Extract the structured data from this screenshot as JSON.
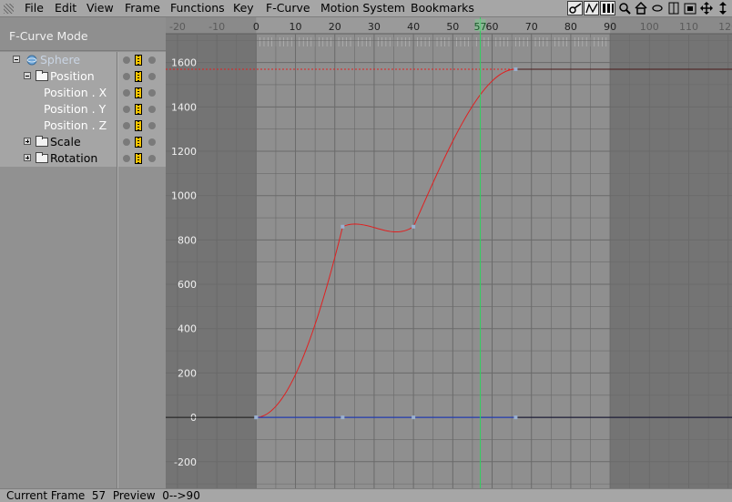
{
  "menu": {
    "items": [
      "File",
      "Edit",
      "View",
      "Frame",
      "Functions",
      "Key",
      "F-Curve",
      "Motion System",
      "Bookmarks"
    ]
  },
  "toolbar": {
    "icons": [
      "key-mode-icon",
      "fcurve-mode-icon",
      "timeline-mode-icon",
      "zoom-icon",
      "home-icon",
      "link-icon",
      "frame-range-icon",
      "frame-all-icon",
      "move-icon",
      "scale-icon"
    ],
    "active": [
      "key-mode-icon",
      "fcurve-mode-icon",
      "timeline-mode-icon"
    ]
  },
  "left_panel": {
    "mode_title": "F-Curve Mode",
    "tree": [
      {
        "label": "Sphere",
        "type": "object",
        "expanded": true,
        "selected": true,
        "color": "#c9d4e3"
      },
      {
        "label": "Position",
        "type": "folder",
        "expanded": true,
        "selected": true
      },
      {
        "label": "Position . X",
        "type": "track",
        "selected": true
      },
      {
        "label": "Position . Y",
        "type": "track",
        "selected": true
      },
      {
        "label": "Position . Z",
        "type": "track",
        "selected": true
      },
      {
        "label": "Scale",
        "type": "folder",
        "expanded": false,
        "selected": true
      },
      {
        "label": "Rotation",
        "type": "folder",
        "expanded": false,
        "selected": true
      }
    ]
  },
  "graph": {
    "x_ticks": [
      "-20",
      "-10",
      "0",
      "10",
      "20",
      "30",
      "40",
      "50",
      "60",
      "70",
      "80",
      "90",
      "100",
      "110",
      "120"
    ],
    "y_ticks": [
      "1600",
      "1400",
      "1200",
      "1000",
      "800",
      "600",
      "400",
      "200",
      "0",
      "-200"
    ],
    "current_frame_label": "57",
    "colors": {
      "active_range": "#8f8f8f",
      "outside_range": "#747474",
      "grid": "#6a6a6a",
      "curve_y": "#e02020",
      "curve_x": "#2040d0",
      "curve_zero": "#1a1a1a",
      "playhead": "#30d060",
      "key": "#9ab0d0"
    }
  },
  "chart_data": {
    "type": "line",
    "x_range": [
      -23,
      121
    ],
    "y_range": [
      -320,
      1730
    ],
    "active_range": [
      0,
      90
    ],
    "current_frame": 57,
    "grid": true,
    "series": [
      {
        "name": "Position . Y",
        "keys": [
          [
            0,
            0
          ],
          [
            22,
            860
          ],
          [
            40,
            860
          ],
          [
            66,
            1570
          ]
        ],
        "hold_after": 1570,
        "color": "#e02020"
      },
      {
        "name": "Position . X",
        "keys": [
          [
            0,
            0
          ],
          [
            22,
            0
          ],
          [
            40,
            0
          ],
          [
            66,
            0
          ]
        ],
        "hold_after": 0,
        "color": "#2040d0"
      }
    ]
  },
  "status": {
    "current_frame_label": "Current Frame",
    "current_frame_value": "57",
    "preview_label": "Preview",
    "preview_range": "0-->90"
  }
}
